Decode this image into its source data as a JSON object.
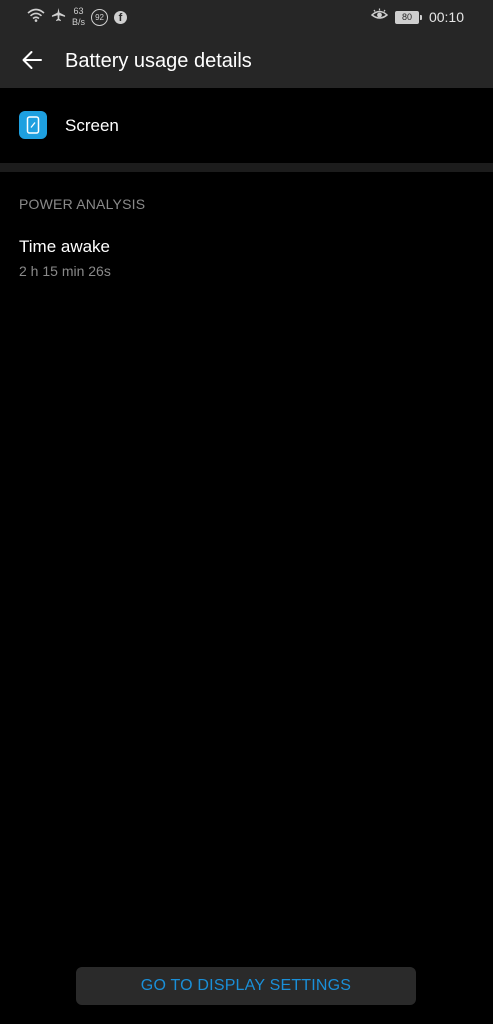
{
  "status_bar": {
    "net_speed_value": "63",
    "net_speed_unit": "B/s",
    "notification_count": "92",
    "battery_level": "80",
    "time": "00:10"
  },
  "header": {
    "title": "Battery usage details"
  },
  "app": {
    "name": "Screen",
    "icon": "phone-screen-icon"
  },
  "power_analysis": {
    "section_title": "POWER ANALYSIS",
    "items": [
      {
        "label": "Time awake",
        "value": "2 h 15 min 26s"
      }
    ]
  },
  "footer": {
    "button_label": "GO TO DISPLAY SETTINGS"
  },
  "colors": {
    "accent": "#1a8fd8",
    "app_icon_bg": "#1ea0e0",
    "bar_bg": "#262626",
    "page_bg": "#000000"
  }
}
